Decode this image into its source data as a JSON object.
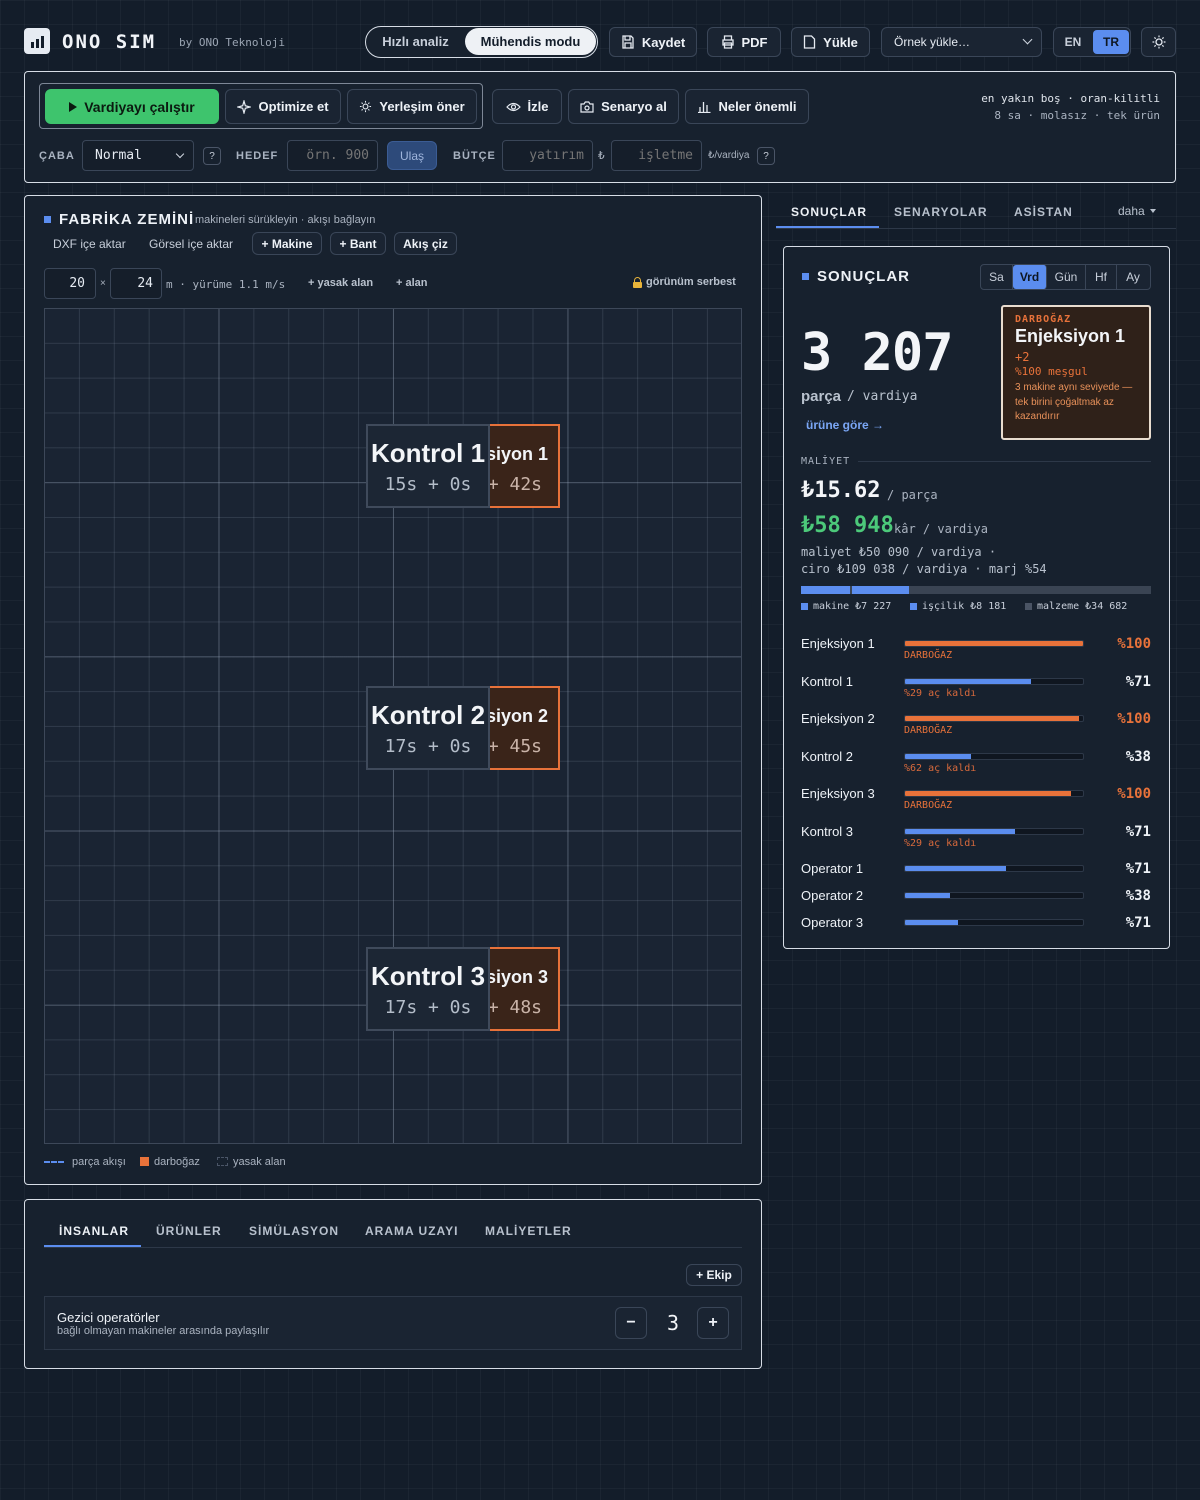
{
  "app": {
    "name": "ONO SIM",
    "by": "by ONO Teknoloji"
  },
  "mode": {
    "quick": "Hızlı analiz",
    "engineer": "Mühendis modu"
  },
  "header": {
    "save": "Kaydet",
    "pdf": "PDF",
    "load": "Yükle",
    "example": "Örnek yükle…",
    "lang_en": "EN",
    "lang_tr": "TR"
  },
  "toolbar": {
    "run": "Vardiyayı çalıştır",
    "optimize": "Optimize et",
    "layout": "Yerleşim öner",
    "watch": "İzle",
    "scenario": "Senaryo al",
    "matters": "Neler önemli",
    "info_line1": "en yakın boş · oran-kilitli",
    "info_line2": "8 sa · molasız · tek ürün"
  },
  "params": {
    "effort_label": "ÇABA",
    "effort_value": "Normal",
    "help": "?",
    "target_label": "HEDEF",
    "target_placeholder": "örn. 900",
    "reach": "Ulaş",
    "budget_label": "BÜTÇE",
    "invest_placeholder": "yatırım",
    "currency": "₺",
    "operate_placeholder": "işletme",
    "per_shift": "₺/vardiya"
  },
  "floor": {
    "title": "FABRİKA ZEMİNİ",
    "subtitle": "makineleri sürükleyin · akışı bağlayın",
    "dxf": "DXF içe aktar",
    "image": "Görsel içe aktar",
    "add_machine": "+ Makine",
    "add_belt": "+ Bant",
    "draw_flow": "Akış çiz",
    "width": "20",
    "times": "×",
    "height": "24",
    "dims_info": "m · yürüme 1.1 m/s",
    "forbidden": "+ yasak alan",
    "area": "+ alan",
    "view": "görünüm serbest",
    "legend": {
      "flow": "parça akışı",
      "bottleneck": "darboğaz",
      "forbidden": "yasak alan"
    },
    "machines": [
      {
        "kontrol": "Kontrol 1",
        "k_time": "15s + 0s",
        "enjeksiyon": "siyon 1",
        "e_time": "+ 42s"
      },
      {
        "kontrol": "Kontrol 2",
        "k_time": "17s + 0s",
        "enjeksiyon": "siyon 2",
        "e_time": "+ 45s"
      },
      {
        "kontrol": "Kontrol 3",
        "k_time": "17s + 0s",
        "enjeksiyon": "siyon 3",
        "e_time": "+ 48s"
      }
    ]
  },
  "side_tabs": {
    "results": "SONUÇLAR",
    "scenarios": "SENARYOLAR",
    "assistant": "ASİSTAN",
    "more": "daha"
  },
  "results": {
    "title": "SONUÇLAR",
    "periods": [
      "Sa",
      "Vrd",
      "Gün",
      "Hf",
      "Ay"
    ],
    "value": "3 207",
    "unit": "parça",
    "per": "/ vardiya",
    "by_product": "ürüne göre →",
    "bottleneck": {
      "label": "DARBOĞAZ",
      "name": "Enjeksiyon 1",
      "more": "+2",
      "busy": "%100 meşgul",
      "note": "3 makine aynı seviyede — tek birini çoğaltmak az kazandırır"
    },
    "cost_label": "MALİYET",
    "cost": "₺15.62",
    "cost_per": "/ parça",
    "profit": "₺58 948",
    "profit_label": "kâr / vardiya",
    "breakdown_1": "maliyet ₺50 090 / vardiya ·",
    "breakdown_2": "ciro ₺109 038 / vardiya · marj %54",
    "legend": {
      "machine": "makine ₺7 227",
      "labor": "işçilik ₺8 181",
      "material": "malzeme ₺34 682"
    },
    "utilization": [
      {
        "name": "Enjeksiyon 1",
        "pct": "%100",
        "value": 1.0,
        "note": "DARBOĞAZ",
        "bottleneck": true
      },
      {
        "name": "Kontrol 1",
        "pct": "%71",
        "value": 0.71,
        "note": "%29 aç kaldı",
        "bottleneck": false
      },
      {
        "name": "Enjeksiyon 2",
        "pct": "%100",
        "value": 0.98,
        "note": "DARBOĞAZ",
        "bottleneck": true
      },
      {
        "name": "Kontrol 2",
        "pct": "%38",
        "value": 0.37,
        "note": "%62 aç kaldı",
        "bottleneck": false
      },
      {
        "name": "Enjeksiyon 3",
        "pct": "%100",
        "value": 0.93,
        "note": "DARBOĞAZ",
        "bottleneck": true
      },
      {
        "name": "Kontrol 3",
        "pct": "%71",
        "value": 0.62,
        "note": "%29 aç kaldı",
        "bottleneck": false
      },
      {
        "name": "Operator 1",
        "pct": "%71",
        "value": 0.57,
        "note": "",
        "bottleneck": false
      },
      {
        "name": "Operator 2",
        "pct": "%38",
        "value": 0.25,
        "note": "",
        "bottleneck": false
      },
      {
        "name": "Operator 3",
        "pct": "%71",
        "value": 0.3,
        "note": "",
        "bottleneck": false
      }
    ]
  },
  "bottom_tabs": [
    "İNSANLAR",
    "ÜRÜNLER",
    "SİMÜLASYON",
    "ARAMA UZAYI",
    "MALİYETLER"
  ],
  "people": {
    "add_team": "+ Ekip",
    "title": "Gezici operatörler",
    "desc": "bağlı olmayan makineler arasında paylaşılır",
    "minus": "−",
    "count": "3",
    "plus": "+"
  },
  "colors": {
    "accent": "#5b8def",
    "bottleneck": "#e8723a",
    "green": "#3ec46d",
    "profit": "#4cc97a"
  }
}
